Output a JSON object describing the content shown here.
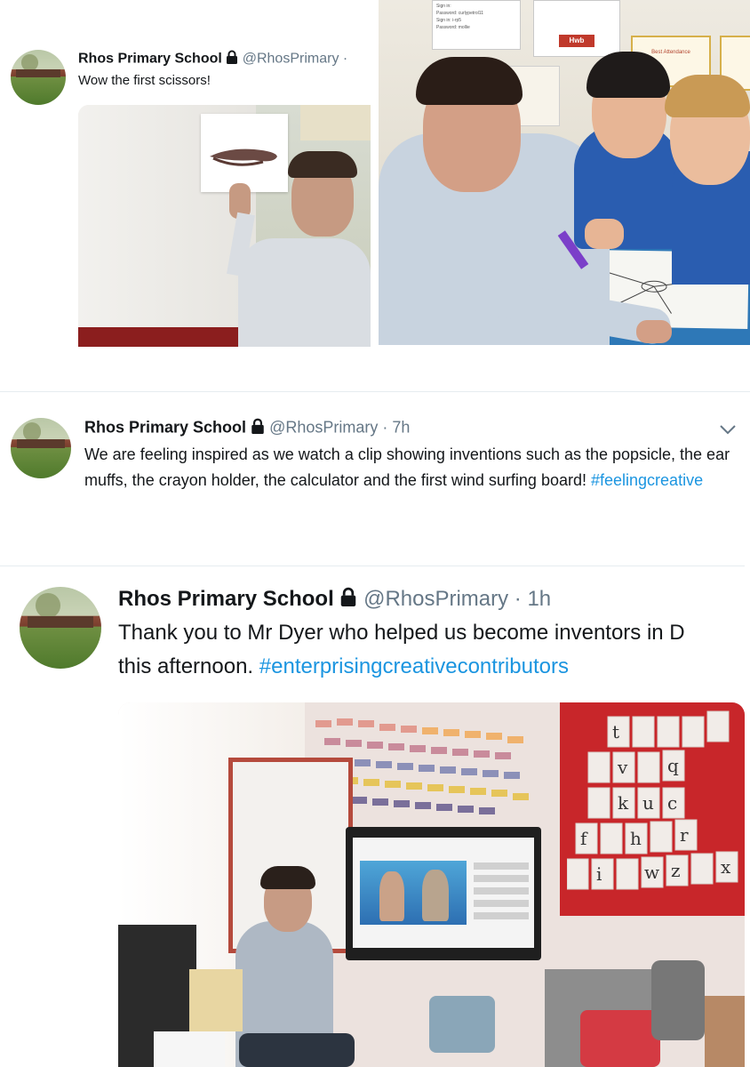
{
  "tweet1": {
    "name": "Rhos Primary School",
    "handle": "@RhosPrimary ·",
    "text": "Wow the first scissors!"
  },
  "photo_top_right": {
    "board_signin": "Sign in:",
    "board_password_1": "Password: curlypetrol11",
    "board_signin_2": "Sign in: i-rp5",
    "board_password_2": "Password: mollie",
    "board_hwb": "Hwb",
    "board_attendance": "Best Attendance"
  },
  "tweet2": {
    "name": "Rhos Primary School",
    "handle": "@RhosPrimary · 7h",
    "text": "We are feeling inspired as we watch a clip showing inventions such as the popsicle, the ear muffs, the crayon holder, the calculator and the first wind surfing board!",
    "hashtag": "#feelingcreative"
  },
  "tweet3": {
    "name": "Rhos Primary School",
    "handle": "@RhosPrimary · 1h",
    "text_line1": "Thank you to Mr Dyer who helped us become inventors in D",
    "text_line2": "this afternoon.",
    "hashtag": "#enterprisingcreativecontributors"
  },
  "alphabet_cards": [
    "t",
    "v",
    "q",
    "k",
    "u",
    "c",
    "f",
    "h",
    "r",
    "i",
    "w",
    "z",
    "x"
  ],
  "colors": {
    "link": "#1b95e0",
    "handle": "#657786",
    "text": "#14171a",
    "divider": "#e6ecf0"
  },
  "icons": {
    "lock": "lock-icon",
    "chevron": "chevron-down-icon"
  }
}
